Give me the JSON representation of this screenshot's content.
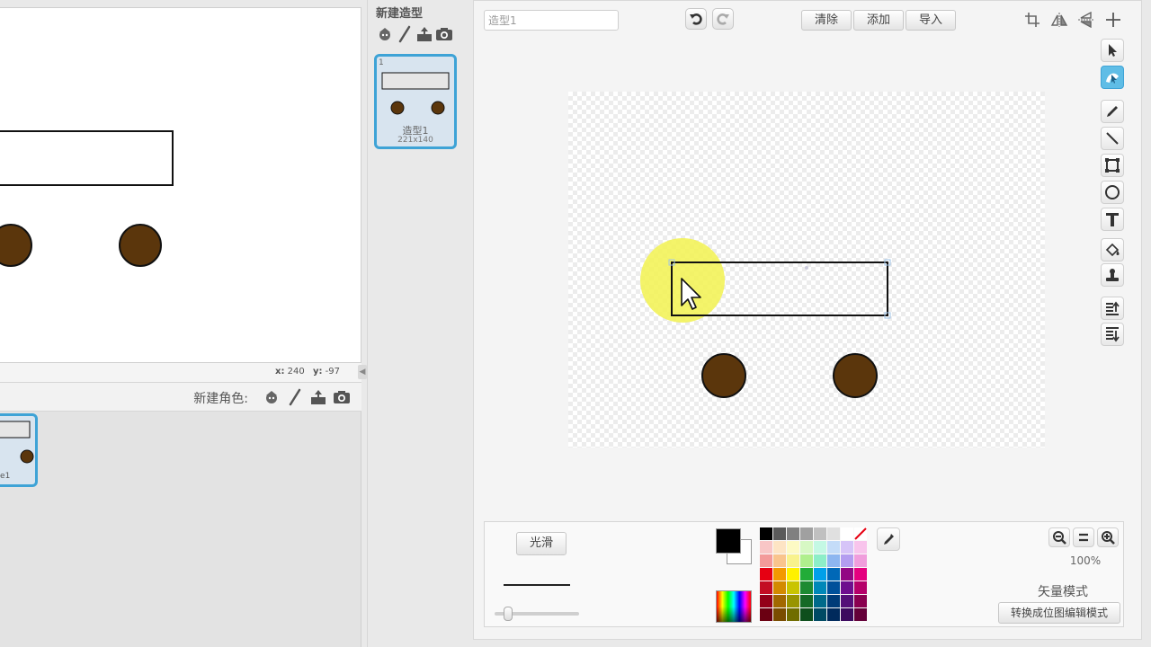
{
  "stage": {
    "coord_x_label": "x:",
    "coord_x_value": "240",
    "coord_y_label": "y:",
    "coord_y_value": "-97"
  },
  "sprites": {
    "new_sprite_label": "新建角色:",
    "thumb_name": "ite1"
  },
  "costumes": {
    "new_costume_label": "新建造型",
    "items": [
      {
        "number": "1",
        "name": "造型1",
        "size": "221x140"
      }
    ]
  },
  "editor": {
    "costume_name_value": "造型1",
    "clear_label": "清除",
    "add_label": "添加",
    "import_label": "导入",
    "smooth_label": "光滑",
    "zoom_level": "100%",
    "mode_label": "矢量模式",
    "convert_label": "转换成位图编辑模式",
    "colors": {
      "foreground": "#000000",
      "background": "#ffffff",
      "shape_fill": "#5b360c",
      "cursor_highlight": "#f3f35a",
      "selection_accent": "#3ea3d6"
    },
    "palette": [
      "#000000",
      "#5a5a5a",
      "#808080",
      "#a0a0a0",
      "#c0c0c0",
      "#e0e0e0",
      "#ffffff",
      "transparent",
      "#f8c6c6",
      "#fde4c4",
      "#fdfac4",
      "#d7f8c4",
      "#c4f8e4",
      "#c4dcf8",
      "#d6c4f8",
      "#f8c4ec",
      "#f39a9a",
      "#f9c48d",
      "#f8f28d",
      "#b0ef8d",
      "#8deec8",
      "#8db6f0",
      "#b39df0",
      "#f09ddc",
      "#e60012",
      "#f39800",
      "#fff100",
      "#22ac38",
      "#00a0e9",
      "#0068b7",
      "#920783",
      "#e4007f",
      "#c30d23",
      "#d38a00",
      "#c9c400",
      "#1d8a32",
      "#0088b8",
      "#00509a",
      "#6e0f8e",
      "#b5006a",
      "#930018",
      "#a26800",
      "#989400",
      "#156a26",
      "#006a8a",
      "#003b78",
      "#541078",
      "#8a0050",
      "#6b0012",
      "#7a4c00",
      "#706d00",
      "#0e4e1c",
      "#004a64",
      "#002a5c",
      "#3c0a5e",
      "#640039"
    ]
  }
}
